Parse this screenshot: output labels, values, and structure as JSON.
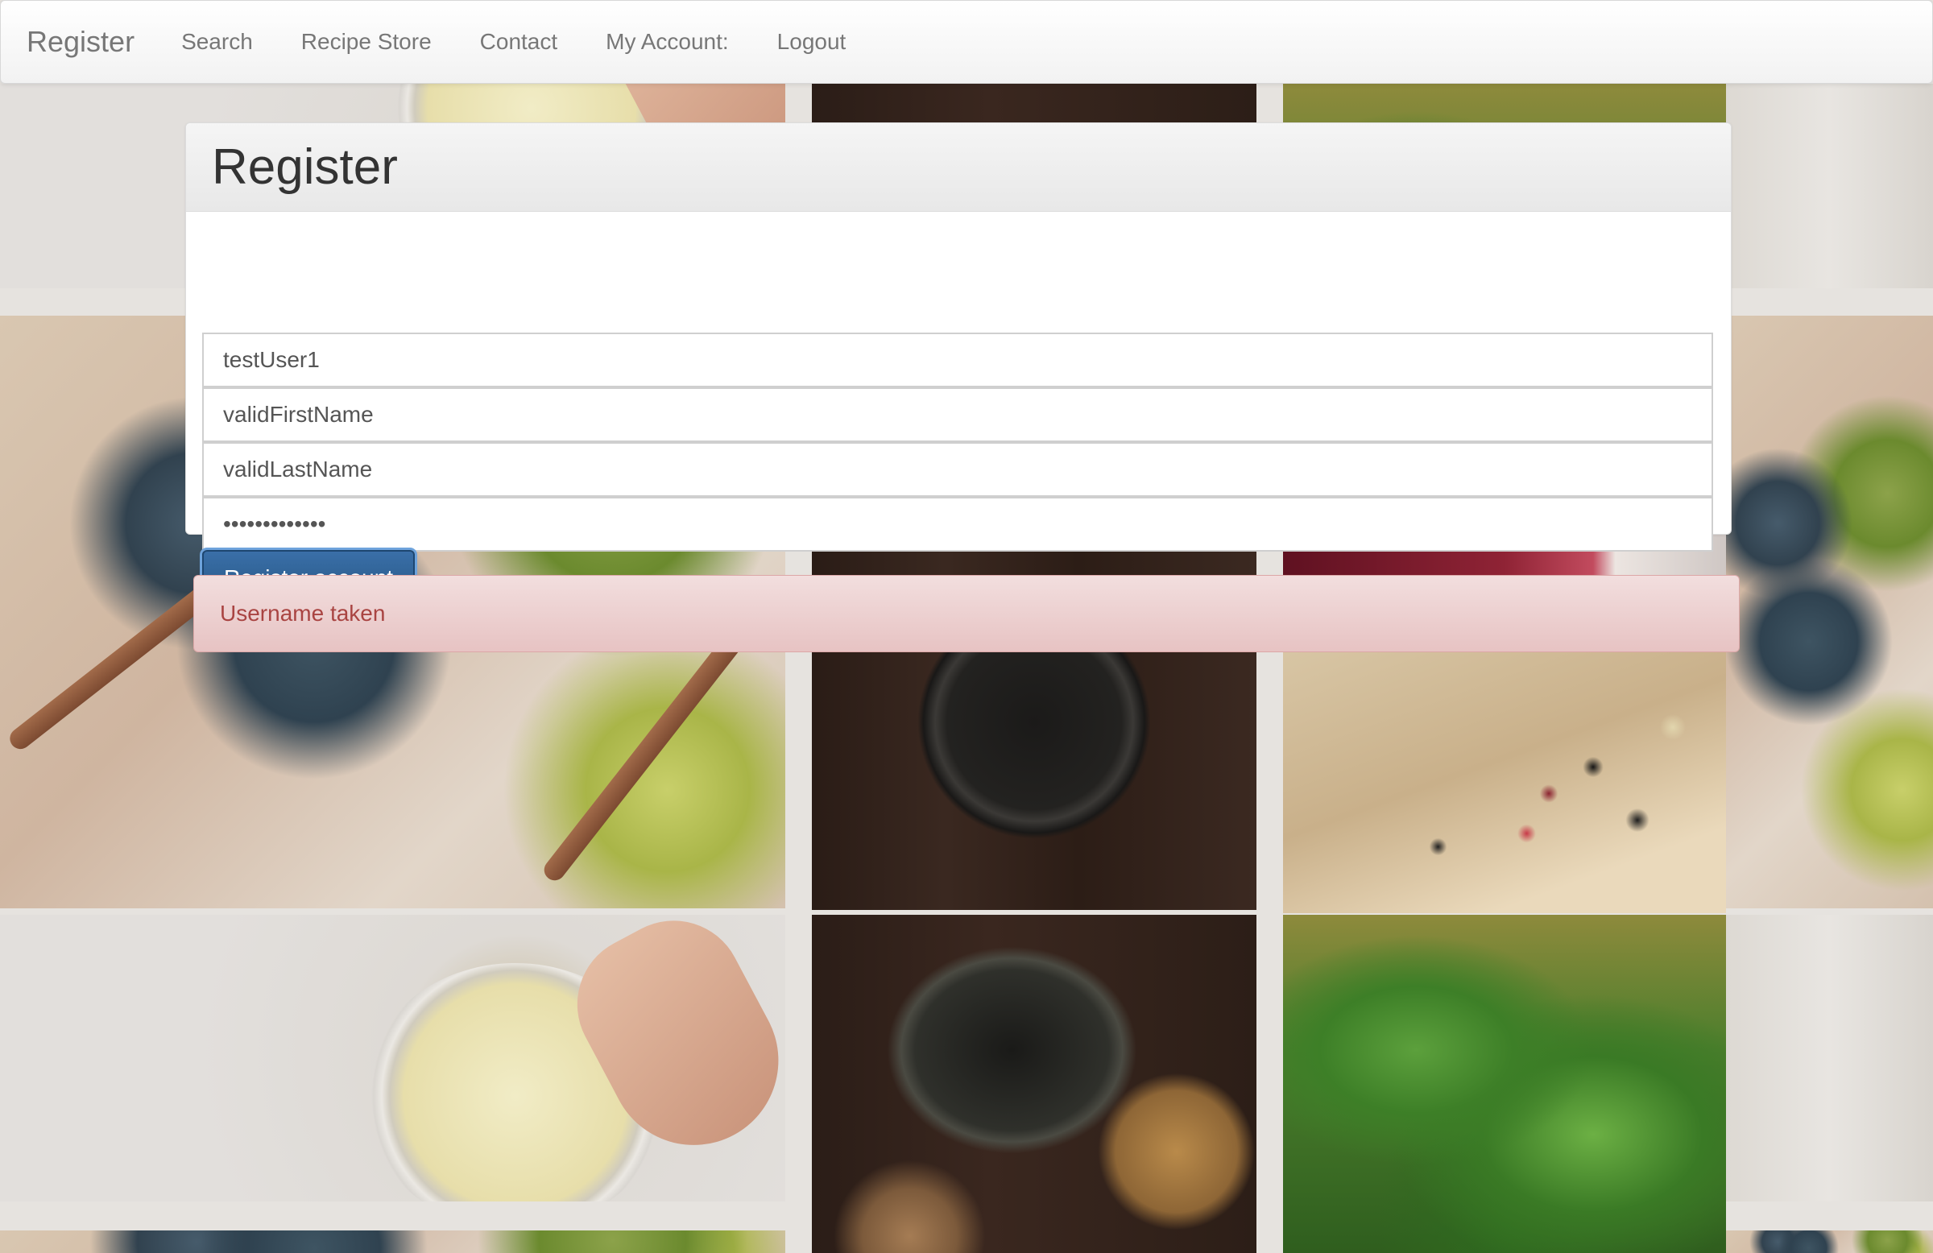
{
  "navbar": {
    "brand": "Register",
    "links": [
      "Search",
      "Recipe Store",
      "Contact",
      "My Account:",
      "Logout"
    ]
  },
  "panel": {
    "title": "Register",
    "fields": {
      "username": "testUser1",
      "first_name": "validFirstName",
      "last_name": "validLastName",
      "password": "•••••••••••••"
    },
    "submit_label": "Register account"
  },
  "alert": {
    "message": "Username taken"
  },
  "colors": {
    "primary_button": "#255683",
    "alert_text": "#a94442",
    "alert_background": "#f2dede"
  }
}
